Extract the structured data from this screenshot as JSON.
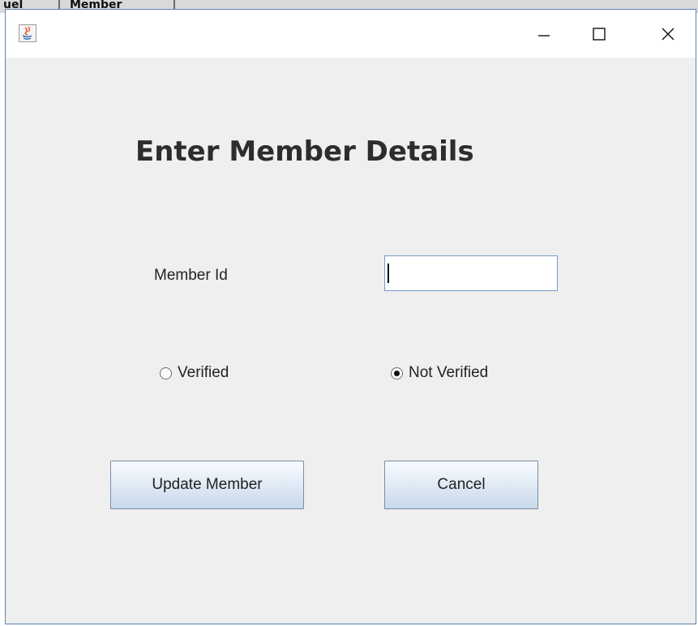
{
  "background_window": {
    "tabs": [
      "uel",
      "Member"
    ]
  },
  "window": {
    "icons": {
      "app": "java-icon",
      "minimize": "minimize-icon",
      "maximize": "maximize-icon",
      "close": "close-icon"
    }
  },
  "form": {
    "title": "Enter Member Details",
    "member_id_label": "Member Id",
    "member_id_value": "",
    "radio_verified": "Verified",
    "radio_not_verified": "Not Verified",
    "selected_radio": "Not Verified",
    "update_button": "Update Member",
    "cancel_button": "Cancel"
  },
  "colors": {
    "window_border": "#5a84b8",
    "content_bg": "#efefef",
    "input_border": "#7a9bc7"
  }
}
